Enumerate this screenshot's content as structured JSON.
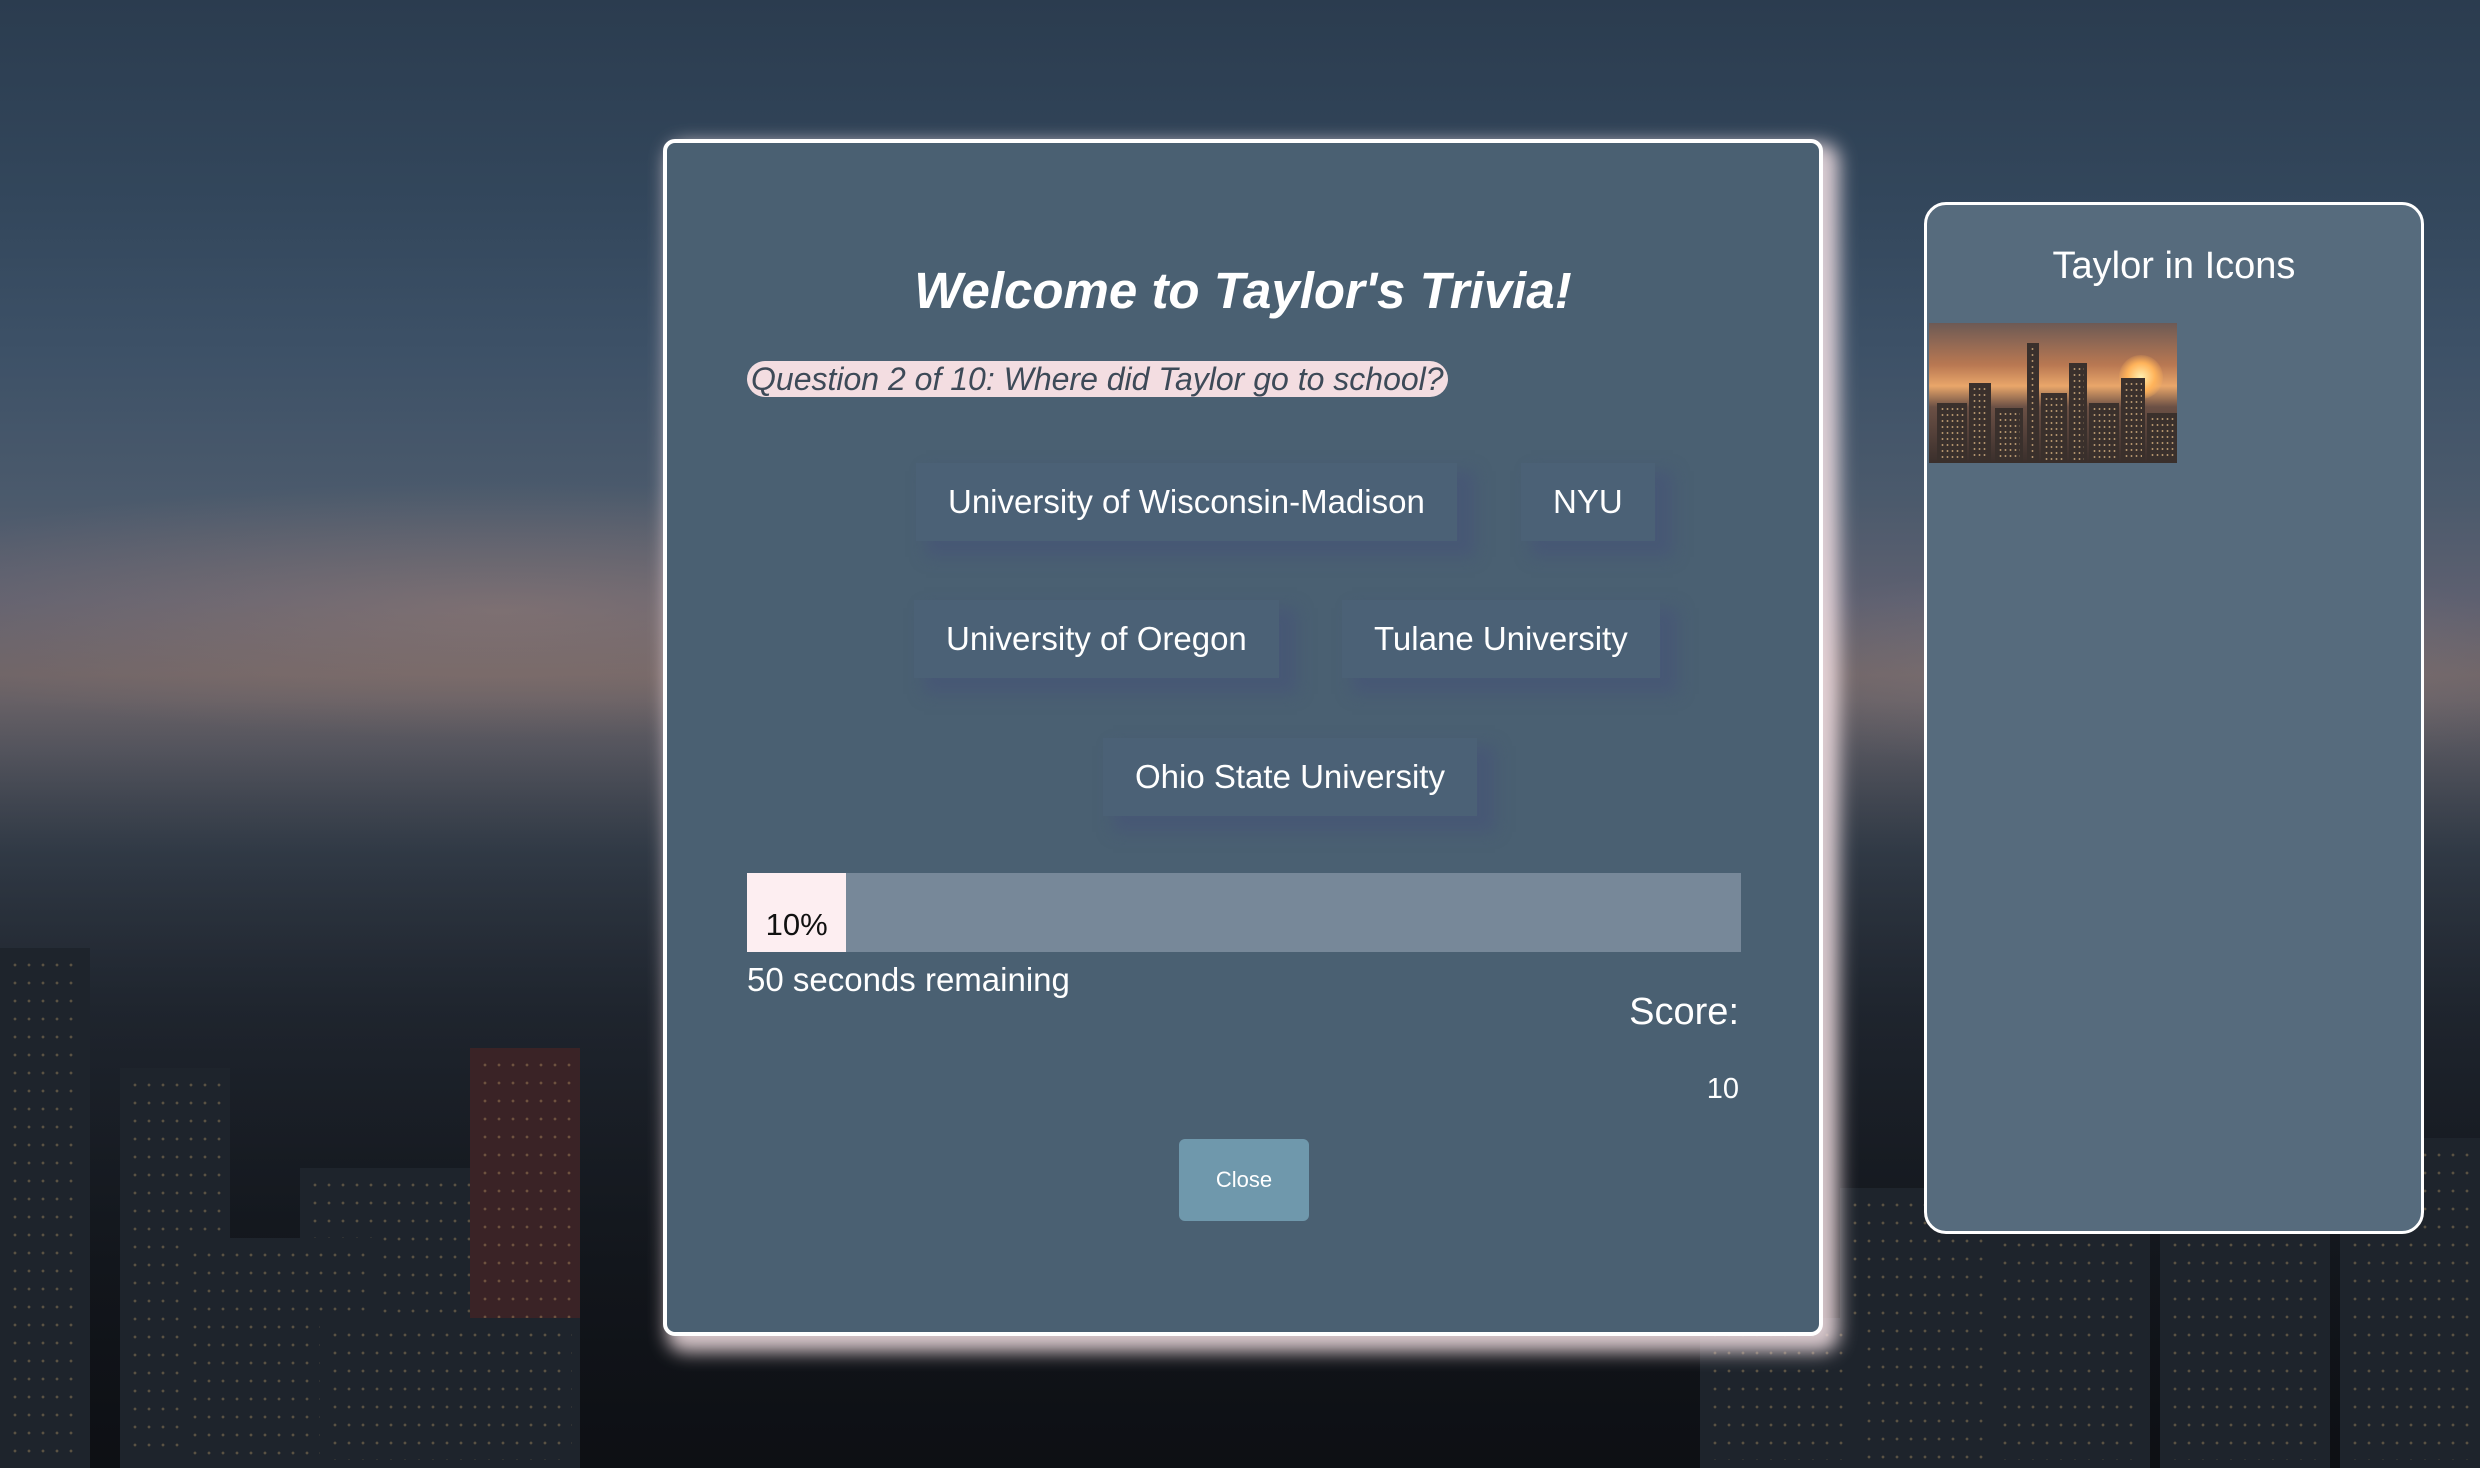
{
  "title": "Welcome to Taylor's Trivia!",
  "question": "Question 2 of 10: Where did Taylor go to school?",
  "answers": [
    "University of Wisconsin-Madison",
    "NYU",
    "University of Oregon",
    "Tulane University",
    "Ohio State University"
  ],
  "progress": {
    "label": "10%",
    "value": 0.1
  },
  "timer": "50 seconds remaining",
  "score": {
    "label": "Score:",
    "value": "10"
  },
  "close_label": "Close",
  "sidebar": {
    "title": "Taylor in Icons",
    "image_alt": "city-skyline-thumbnail"
  },
  "colors": {
    "panel_bg": "#4a6072",
    "side_bg": "#566b7d",
    "question_highlight": "#f3dde1",
    "progress_fill": "#fdeef1",
    "progress_track": "#778899",
    "close_button": "#6f98ac"
  }
}
